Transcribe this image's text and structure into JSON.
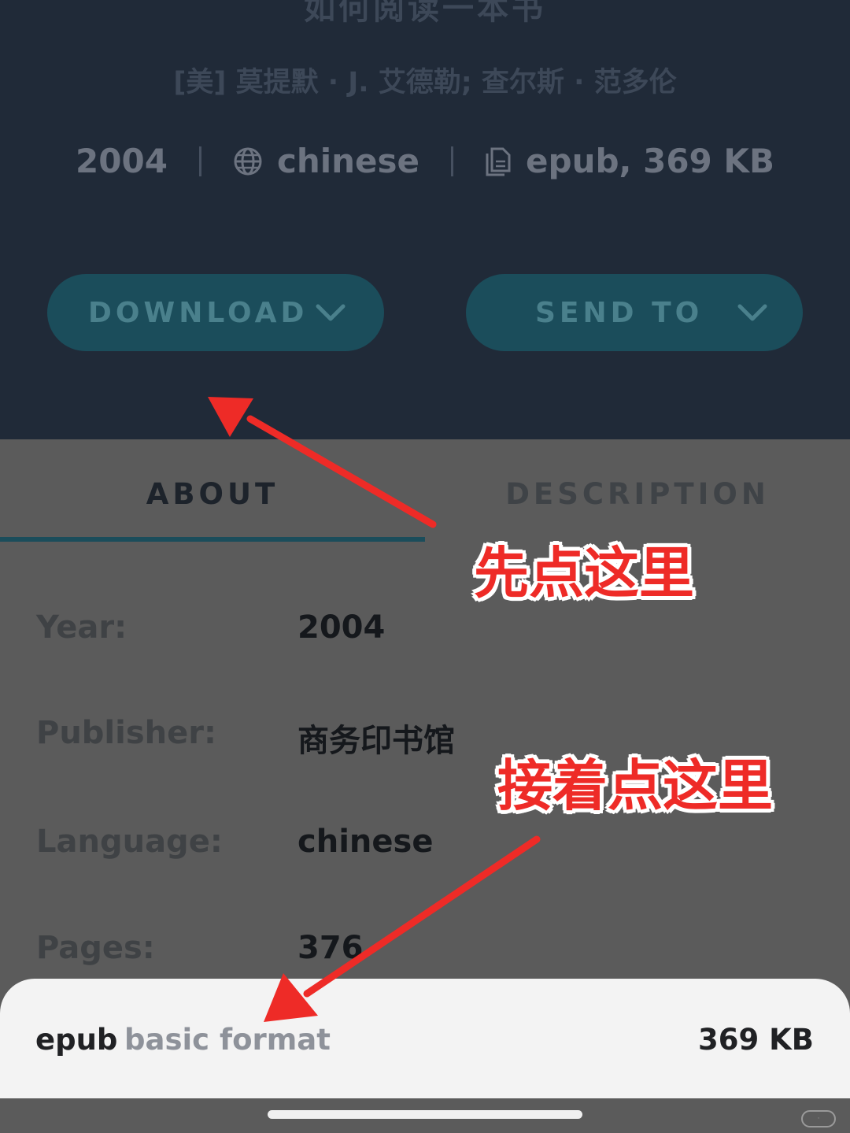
{
  "book": {
    "title": "如何阅读一本书",
    "author": "[美] 莫提默 · J. 艾德勒; 查尔斯 · 范多伦",
    "year": "2004",
    "language": "chinese",
    "file_info": "epub, 369 KB"
  },
  "buttons": {
    "download_label": "DOWNLOAD",
    "send_to_label": "SEND TO"
  },
  "tabs": {
    "about": "ABOUT",
    "description": "DESCRIPTION"
  },
  "details": [
    {
      "label": "Year:",
      "value": "2004"
    },
    {
      "label": "Publisher:",
      "value": "商务印书馆"
    },
    {
      "label": "Language:",
      "value": "chinese"
    },
    {
      "label": "Pages:",
      "value": "376"
    }
  ],
  "sheet": {
    "format_name": "epub",
    "format_desc": "basic format",
    "size": "369 KB"
  },
  "annotations": {
    "first": "先点这里",
    "second": "接着点这里"
  },
  "colors": {
    "header_bg": "#202a38",
    "button_bg": "#1b4d5b",
    "annotation_red": "#ee2b27"
  },
  "icons": [
    "globe-icon",
    "document-icon",
    "chevron-down-icon",
    "arrow-icon"
  ]
}
